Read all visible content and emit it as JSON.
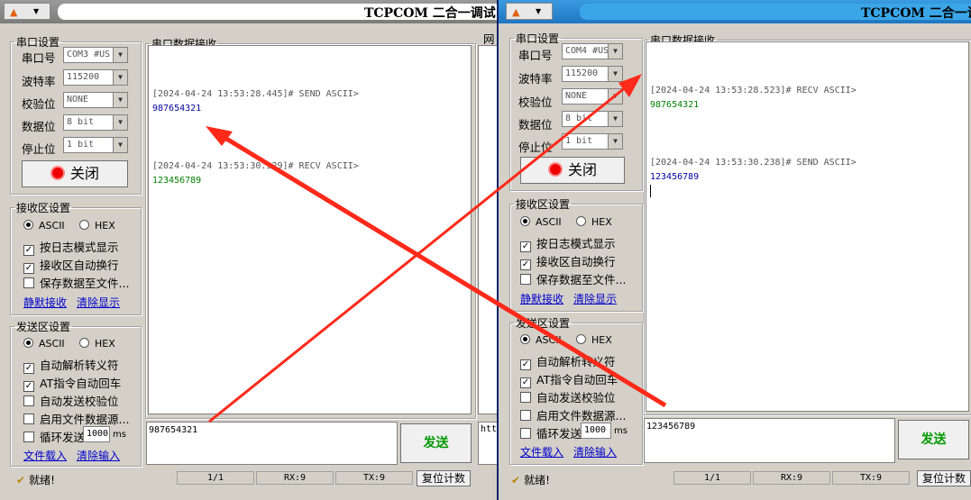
{
  "app_title": "TCPCOM 二合一调试",
  "w1": {
    "serial_settings": {
      "legend": "串口设置",
      "port_label": "串口号",
      "port_value": "COM3 #US",
      "baud_label": "波特率",
      "baud_value": "115200",
      "parity_label": "校验位",
      "parity_value": "NONE",
      "databits_label": "数据位",
      "databits_value": "8 bit",
      "stopbits_label": "停止位",
      "stopbits_value": "1 bit",
      "close_label": "关闭"
    },
    "recv_settings": {
      "legend": "接收区设置",
      "ascii": "ASCII",
      "hex": "HEX",
      "opt1": "按日志模式显示",
      "opt2": "接收区自动换行",
      "opt3": "保存数据至文件...",
      "link1": "静默接收",
      "link2": "清除显示"
    },
    "send_settings": {
      "legend": "发送区设置",
      "ascii": "ASCII",
      "hex": "HEX",
      "opt1": "自动解析转义符",
      "opt2": "AT指令自动回车",
      "opt3": "自动发送校验位",
      "opt4": "启用文件数据源...",
      "opt5": "循环发送",
      "interval": "1000",
      "unit": "ms",
      "link1": "文件载入",
      "link2": "清除输入"
    },
    "recv_panel_title": "串口数据接收",
    "side_panel_title": "网",
    "side_panel_text": "htt",
    "log": [
      {
        "ts": "[2024-04-24 13:53:28.445]# SEND ASCII>",
        "payload": "987654321",
        "color": "#0000a0"
      },
      {
        "ts": "[2024-04-24 13:53:30.329]# RECV ASCII>",
        "payload": "123456789",
        "color": "#008000"
      }
    ],
    "send_input": "987654321",
    "send_button": "发送",
    "status": {
      "ready": "就绪!",
      "page": "1/1",
      "rx": "RX:9",
      "tx": "TX:9",
      "reset": "复位计数"
    }
  },
  "w2": {
    "serial_settings": {
      "legend": "串口设置",
      "port_label": "串口号",
      "port_value": "COM4 #US",
      "baud_label": "波特率",
      "baud_value": "115200",
      "parity_label": "校验位",
      "parity_value": "NONE",
      "databits_label": "数据位",
      "databits_value": "8 bit",
      "stopbits_label": "停止位",
      "stopbits_value": "1 bit",
      "close_label": "关闭"
    },
    "recv_settings": {
      "legend": "接收区设置",
      "ascii": "ASCII",
      "hex": "HEX",
      "opt1": "按日志模式显示",
      "opt2": "接收区自动换行",
      "opt3": "保存数据至文件...",
      "link1": "静默接收",
      "link2": "清除显示"
    },
    "send_settings": {
      "legend": "发送区设置",
      "ascii": "ASCII",
      "hex": "HEX",
      "opt1": "自动解析转义符",
      "opt2": "AT指令自动回车",
      "opt3": "自动发送校验位",
      "opt4": "启用文件数据源...",
      "opt5": "循环发送",
      "interval": "1000",
      "unit": "ms",
      "link1": "文件载入",
      "link2": "清除输入"
    },
    "recv_panel_title": "串口数据接收",
    "log": [
      {
        "ts": "[2024-04-24 13:53:28.523]# RECV ASCII>",
        "payload": "987654321",
        "color": "#008000"
      },
      {
        "ts": "[2024-04-24 13:53:30.238]# SEND ASCII>",
        "payload": "123456789",
        "color": "#0000a0"
      }
    ],
    "send_input": "123456789",
    "send_button": "发送",
    "status": {
      "ready": "就绪!",
      "page": "1/1",
      "rx": "RX:9",
      "tx": "TX:9",
      "reset": "复位计数"
    }
  },
  "annotation_color": "#ff2a1a"
}
